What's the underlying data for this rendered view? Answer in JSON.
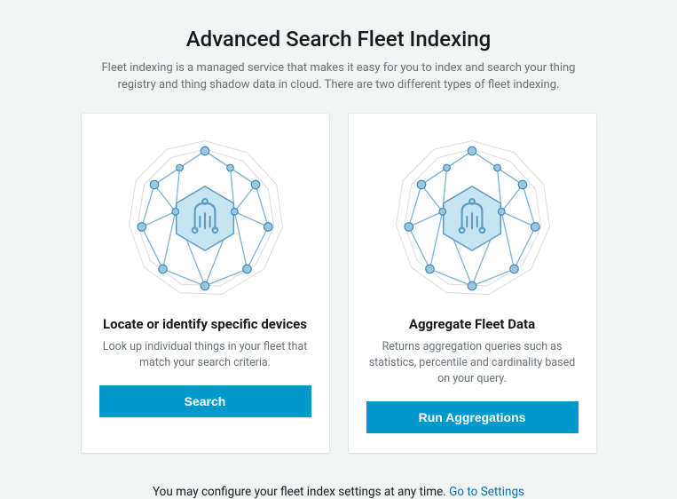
{
  "header": {
    "title": "Advanced Search Fleet Indexing",
    "subtitle": "Fleet indexing is a managed service that makes it easy for you to index and search your thing registry and thing shadow data in cloud. There are two different types of fleet indexing."
  },
  "cards": [
    {
      "title": "Locate or identify specific devices",
      "description": "Look up individual things in your fleet that match your search criteria.",
      "button_label": "Search"
    },
    {
      "title": "Aggregate Fleet Data",
      "description": "Returns aggregation queries such as statistics, percentile and cardinality based on your query.",
      "button_label": "Run Aggregations"
    }
  ],
  "footer": {
    "text": "You may configure your fleet index settings at any time. ",
    "link_label": "Go to Settings"
  }
}
